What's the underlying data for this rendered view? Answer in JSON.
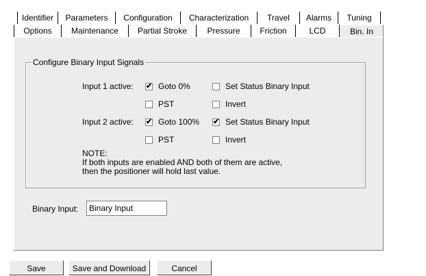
{
  "tabs_row1": [
    "Identifier",
    "Parameters",
    "Configuration",
    "Characterization",
    "Travel",
    "Alarms",
    "Tuning"
  ],
  "tabs_row2": [
    "Options",
    "Maintenance",
    "Partial Stroke",
    "Pressure",
    "Friction",
    "LCD",
    "Bin. In"
  ],
  "active_tab": "Bin. In",
  "group": {
    "title": "Configure Binary Input Signals",
    "input1_label": "Input 1 active:",
    "input2_label": "Input 2 active:",
    "input1": [
      {
        "label": "Goto 0%",
        "checked": true
      },
      {
        "label": "Set Status Binary Input",
        "checked": false
      },
      {
        "label": "PST",
        "checked": false
      },
      {
        "label": "Invert",
        "checked": false
      }
    ],
    "input2": [
      {
        "label": "Goto 100%",
        "checked": true
      },
      {
        "label": "Set Status Binary Input",
        "checked": true
      },
      {
        "label": "PST",
        "checked": false
      },
      {
        "label": "Invert",
        "checked": false
      }
    ],
    "note": "NOTE:\nIf both inputs are enabled AND both of them are active,\nthen the positioner will hold last value."
  },
  "binary_input": {
    "label": "Binary Input:",
    "value": "Binary Input"
  },
  "buttons": {
    "save": "Save",
    "save_download": "Save and Download",
    "cancel": "Cancel"
  }
}
